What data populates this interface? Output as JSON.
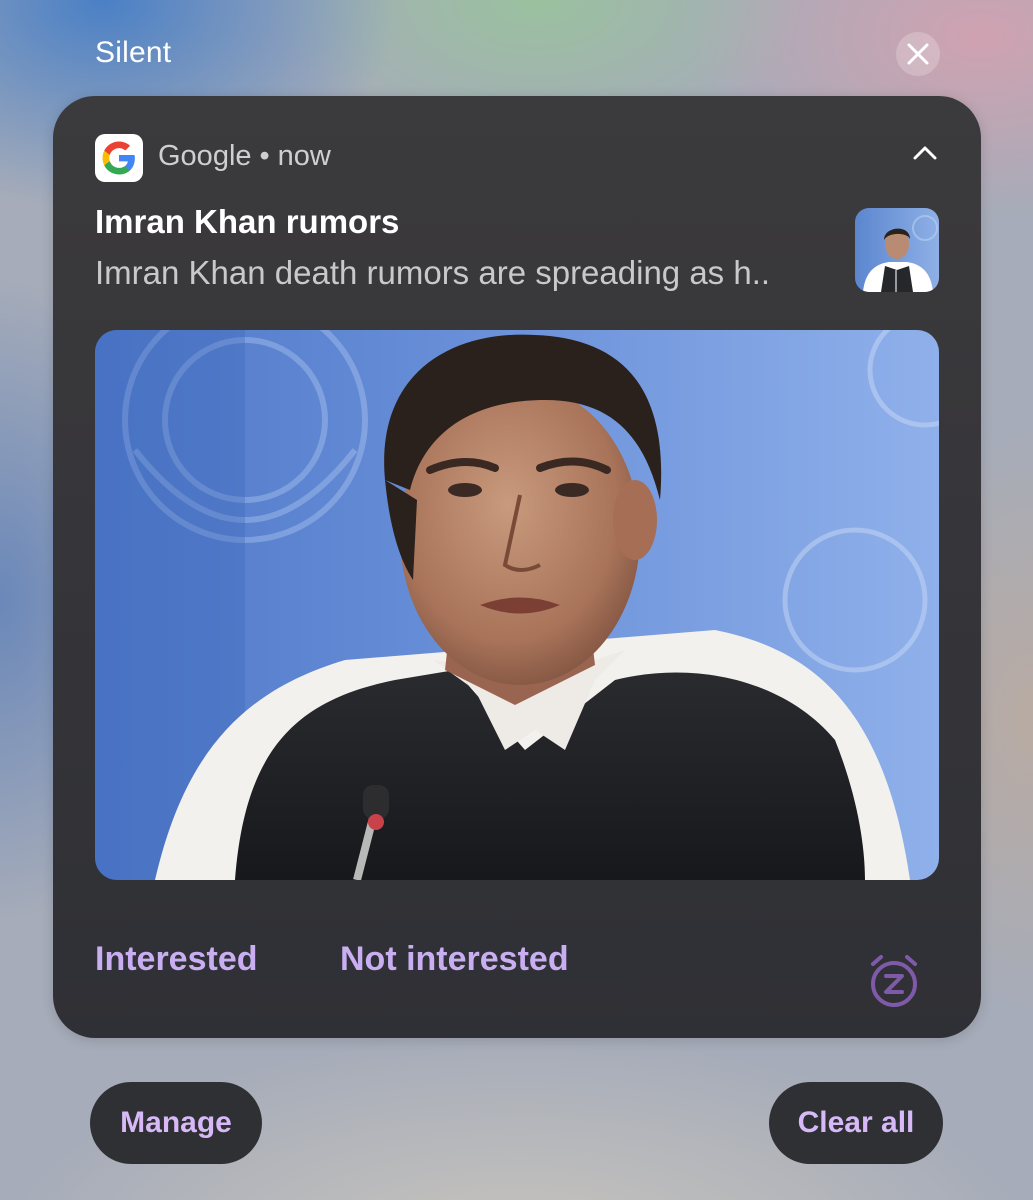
{
  "section": {
    "title": "Silent"
  },
  "notification": {
    "app_name": "Google",
    "separator": "•",
    "time": "now",
    "title": "Imran Khan rumors",
    "body": "Imran Khan death rumors are spreading as h..",
    "image_subject": "Imran Khan portrait photo",
    "actions": {
      "interested": "Interested",
      "not_interested": "Not interested"
    }
  },
  "footer": {
    "manage": "Manage",
    "clear_all": "Clear all"
  },
  "icons": {
    "dismiss": "close-icon",
    "app": "google-g-icon",
    "collapse": "chevron-up-icon",
    "snooze": "snooze-alarm-icon"
  },
  "colors": {
    "accent": "#c9aef2",
    "card_background": "#37363a",
    "pill_background": "#2f3034"
  }
}
